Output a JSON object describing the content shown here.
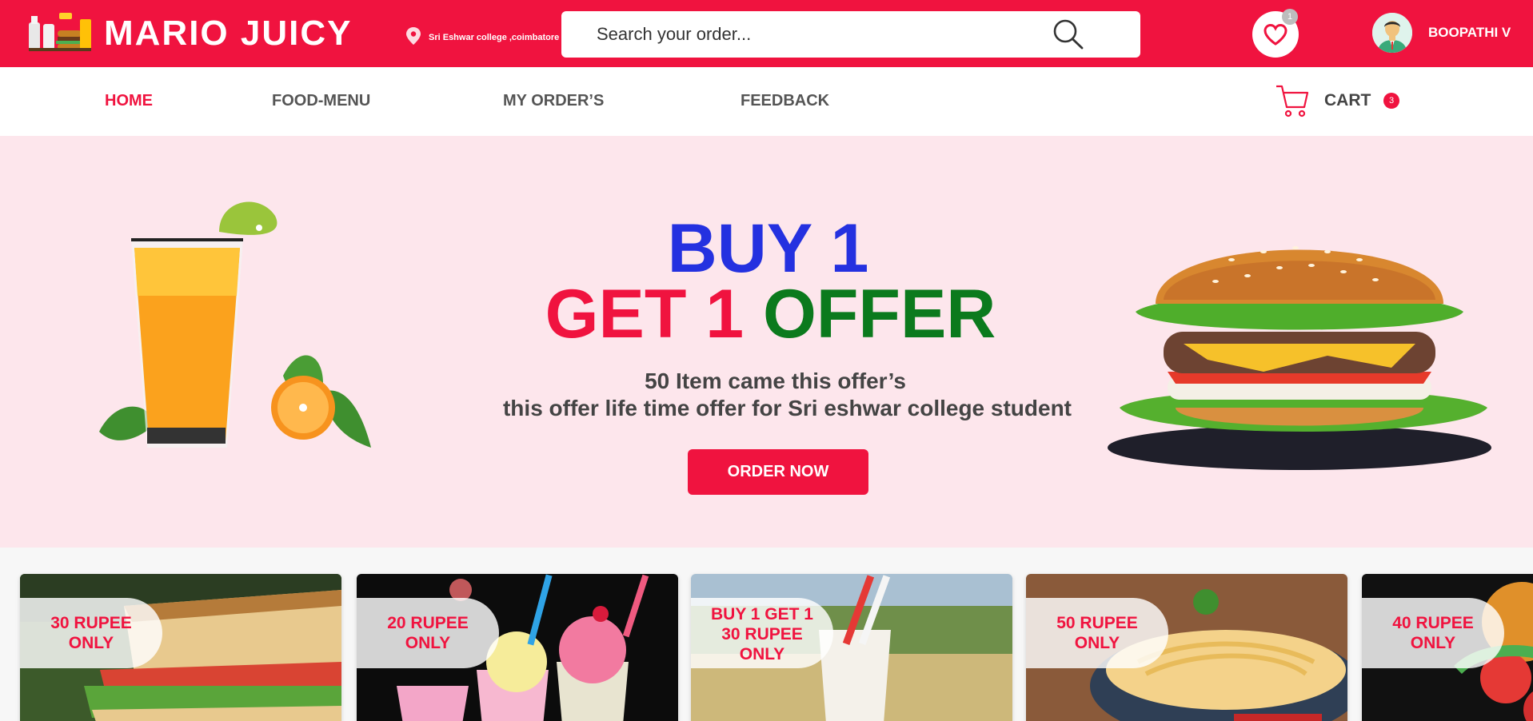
{
  "header": {
    "brand": "MARIO JUICY",
    "location": "Sri Eshwar college ,coimbatore",
    "search_placeholder": "Search your order...",
    "wishlist_count": "1",
    "username": "BOOPATHI V",
    "icons": [
      "location-pin-icon",
      "search-icon",
      "heart-icon",
      "avatar"
    ]
  },
  "nav": {
    "items": [
      {
        "label": "HOME",
        "active": true
      },
      {
        "label": "FOOD-MENU",
        "active": false
      },
      {
        "label": "MY ORDER’S",
        "active": false
      },
      {
        "label": "FEEDBACK",
        "active": false
      }
    ],
    "cart_label": "CART",
    "cart_count": "3"
  },
  "hero": {
    "line1": "BUY 1",
    "line2_red": "GET 1",
    "line2_green": "OFFER",
    "sub1": "50 Item came this offer’s",
    "sub2": "this offer life time offer for Sri eshwar college student",
    "button": "ORDER NOW"
  },
  "offers": [
    {
      "lines": [
        "30 RUPEE",
        "ONLY"
      ],
      "item": "sandwich"
    },
    {
      "lines": [
        "20 RUPEE",
        "ONLY"
      ],
      "item": "milkshakes"
    },
    {
      "lines": [
        "BUY 1 GET 1",
        "30 RUPEE",
        "ONLY"
      ],
      "item": "milk"
    },
    {
      "lines": [
        "50 RUPEE",
        "ONLY"
      ],
      "item": "noodles"
    },
    {
      "lines": [
        "40 RUPEE",
        "ONLY"
      ],
      "item": "salad"
    }
  ],
  "colors": {
    "brand_red": "#f0133f",
    "hero_bg": "#fde6ec",
    "headline_blue": "#2431e0",
    "headline_green": "#0b7a1d"
  }
}
